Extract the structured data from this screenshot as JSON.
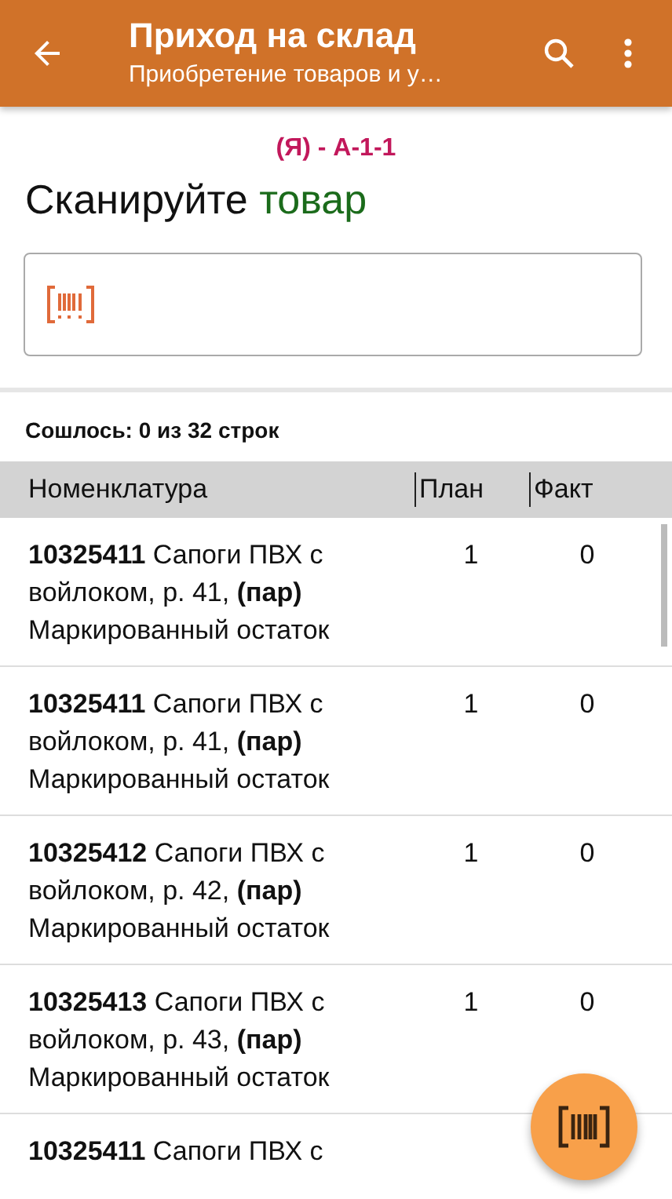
{
  "app_bar": {
    "title": "Приход на склад",
    "subtitle": "Приобретение товаров и у…"
  },
  "location": "(Я) - А-1-1",
  "prompt": {
    "text": "Сканируйте",
    "highlight": "товар"
  },
  "summary": "Сошлось: 0 из 32 строк",
  "table": {
    "columns": [
      "Номенклатура",
      "План",
      "Факт"
    ],
    "rows": [
      {
        "name": "**10325411** Сапоги ПВХ с войлоком, р. 41, **(пар)** Маркированный остаток",
        "plan": "1",
        "fact": "0"
      },
      {
        "name": "**10325411** Сапоги ПВХ с войлоком, р. 41, **(пар)** Маркированный остаток",
        "plan": "1",
        "fact": "0"
      },
      {
        "name": "**10325412** Сапоги ПВХ с войлоком, р. 42, **(пар)** Маркированный остаток",
        "plan": "1",
        "fact": "0"
      },
      {
        "name": "**10325413** Сапоги ПВХ с войлоком, р. 43, **(пар)** Маркированный остаток",
        "plan": "1",
        "fact": "0"
      },
      {
        "name": "**10325411** Сапоги ПВХ с"
      }
    ]
  }
}
